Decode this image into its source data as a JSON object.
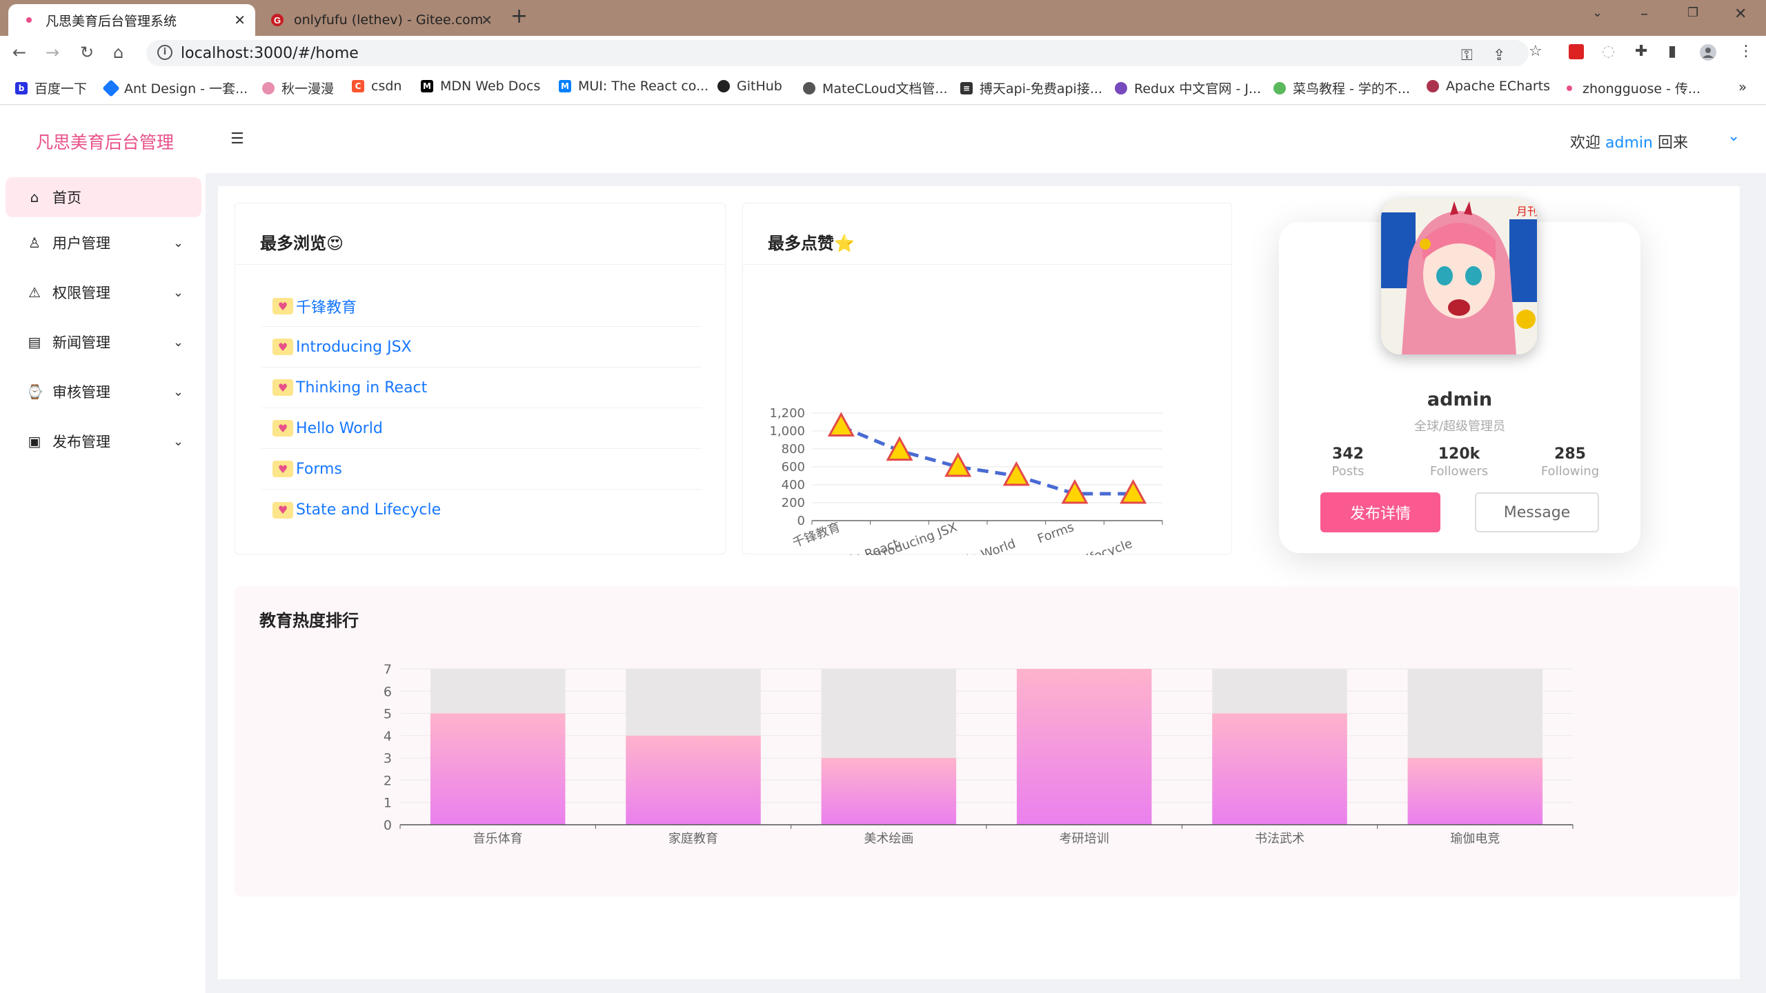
{
  "browser": {
    "tabs": [
      {
        "title": "凡思美育后台管理系统",
        "active": true
      },
      {
        "title": "onlyfufu (lethev) - Gitee.com",
        "active": false
      }
    ],
    "url": "localhost:3000/#/home",
    "bookmarks": [
      {
        "label": "百度一下",
        "icon": "baidu-icon",
        "color": "#2932e1"
      },
      {
        "label": "Ant Design - 一套...",
        "icon": "antdesign-icon",
        "color": "#1677ff"
      },
      {
        "label": "秋一漫漫",
        "icon": "flower-icon",
        "color": "#e88fb0"
      },
      {
        "label": "csdn",
        "icon": "csdn-icon",
        "color": "#fc5531"
      },
      {
        "label": "MDN Web Docs",
        "icon": "mdn-icon",
        "color": "#000000"
      },
      {
        "label": "MUI: The React co...",
        "icon": "mui-icon",
        "color": "#007fff"
      },
      {
        "label": "GitHub",
        "icon": "github-icon",
        "color": "#222222"
      },
      {
        "label": "MateCLoud文档管...",
        "icon": "globe-icon",
        "color": "#555555"
      },
      {
        "label": "搏天api-免费api接...",
        "icon": "doc-icon",
        "color": "#333333"
      },
      {
        "label": "Redux 中文官网 - J...",
        "icon": "redux-icon",
        "color": "#764abc"
      },
      {
        "label": "菜鸟教程 - 学的不...",
        "icon": "runoob-icon",
        "color": "#5cb85c"
      },
      {
        "label": "Apache ECharts",
        "icon": "echarts-icon",
        "color": "#aa344d"
      },
      {
        "label": "zhongguose - 传...",
        "icon": "dot-icon",
        "color": "#e8508a"
      }
    ]
  },
  "header": {
    "logo": "凡思美育后台管理",
    "welcome_prefix": "欢迎",
    "username": "admin",
    "welcome_suffix": "回来"
  },
  "sidebar": {
    "items": [
      {
        "label": "首页",
        "icon": "home-icon",
        "active": true
      },
      {
        "label": "用户管理",
        "icon": "user-icon"
      },
      {
        "label": "权限管理",
        "icon": "warning-icon"
      },
      {
        "label": "新闻管理",
        "icon": "news-icon"
      },
      {
        "label": "审核管理",
        "icon": "watch-icon"
      },
      {
        "label": "发布管理",
        "icon": "publish-icon"
      }
    ]
  },
  "most_viewed": {
    "title": "最多浏览",
    "title_emoji": "😍",
    "items": [
      "千锋教育",
      "Introducing JSX",
      "Thinking in React",
      "Hello World",
      "Forms",
      "State and Lifecycle"
    ]
  },
  "most_liked": {
    "title": "最多点赞",
    "title_emoji": "⭐"
  },
  "profile": {
    "name": "admin",
    "role": "全球/超级管理员",
    "stats": [
      {
        "value": "342",
        "label": "Posts"
      },
      {
        "value": "120k",
        "label": "Followers"
      },
      {
        "value": "285",
        "label": "Following"
      }
    ],
    "publish_button": "发布详情",
    "message_button": "Message"
  },
  "ranking": {
    "title": "教育热度排行"
  },
  "chart_data": [
    {
      "type": "line",
      "title": "最多点赞",
      "categories": [
        "千锋教育",
        "Thinking in React",
        "Introducing JSX",
        "Hello World",
        "Forms",
        "State and Lifecycle"
      ],
      "values": [
        1050,
        780,
        600,
        500,
        300,
        300
      ],
      "yticks": [
        0,
        200,
        400,
        600,
        800,
        1000,
        1200
      ],
      "ylim": [
        0,
        1200
      ],
      "line_color": "#4a6bd3",
      "marker": "triangle",
      "marker_fill": "#ffd400",
      "marker_stroke": "#e34a4a"
    },
    {
      "type": "bar",
      "title": "教育热度排行",
      "categories": [
        "音乐体育",
        "家庭教育",
        "美术绘画",
        "考研培训",
        "书法武术",
        "瑜伽电竞"
      ],
      "values": [
        5,
        4,
        3,
        7,
        5,
        3
      ],
      "background_max": 7,
      "yticks": [
        0,
        1,
        2,
        3,
        4,
        5,
        6,
        7
      ],
      "ylim": [
        0,
        7
      ],
      "gradient_top": "#ffb3cc",
      "gradient_bottom": "#ea80ee"
    }
  ]
}
